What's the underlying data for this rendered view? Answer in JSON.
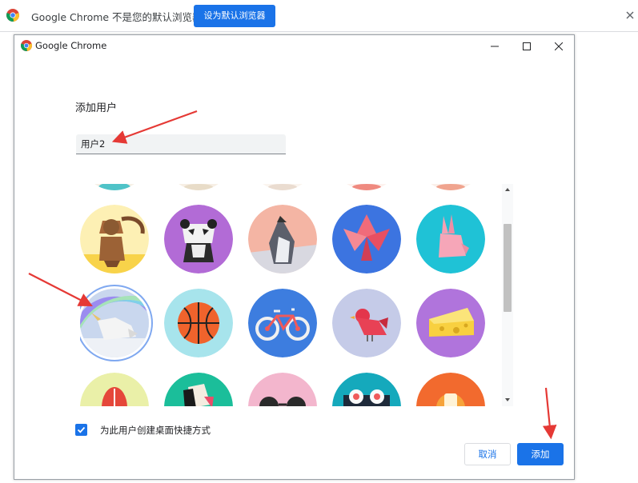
{
  "infobar": {
    "message": "Google Chrome 不是您的默认浏览器",
    "set_default_label": "设为默认浏览器",
    "icons": [
      "chrome-logo-icon",
      "close-icon"
    ]
  },
  "dialog": {
    "window_title": "Google Chrome",
    "heading": "添加用户",
    "name_value": "用户2",
    "avatars": [
      {
        "name": "monkey"
      },
      {
        "name": "panda"
      },
      {
        "name": "penguin"
      },
      {
        "name": "butterfly"
      },
      {
        "name": "rabbit"
      },
      {
        "name": "unicorn",
        "selected": true
      },
      {
        "name": "basketball"
      },
      {
        "name": "bicycle"
      },
      {
        "name": "bird"
      },
      {
        "name": "cheese"
      },
      {
        "name": "football"
      },
      {
        "name": "burger"
      },
      {
        "name": "sunglasses"
      },
      {
        "name": "sushi"
      },
      {
        "name": "fox"
      }
    ],
    "shortcut_checkbox": {
      "label": "为此用户创建桌面快捷方式",
      "checked": true
    },
    "cancel_label": "取消",
    "add_label": "添加"
  },
  "colors": {
    "accent": "#1a73e8",
    "annotation_arrow": "#e53935"
  }
}
